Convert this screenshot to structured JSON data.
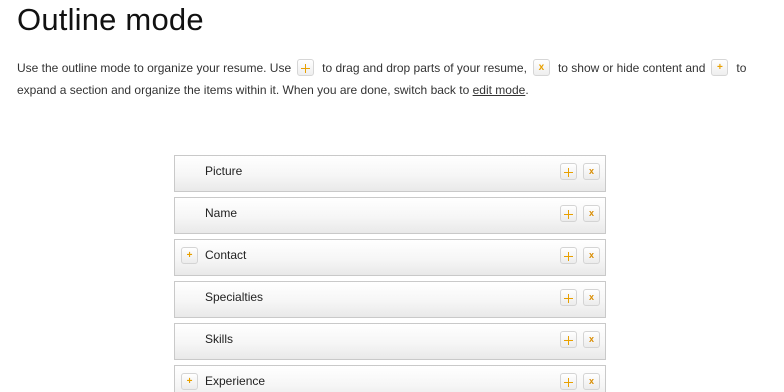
{
  "page": {
    "title": "Outline mode"
  },
  "intro": {
    "text_1": "Use the outline mode to organize your resume. Use",
    "text_2": "to drag and drop parts of your resume,",
    "text_3": "to show or hide content and",
    "text_4": "to",
    "text_5": "expand a section and organize the items within it. When you are done, switch back to",
    "edit_mode_link": "edit mode",
    "text_6": ".",
    "move_icon": "move-arrows-icon",
    "hide_icon": "x-icon",
    "expand_icon": "plus-icon"
  },
  "outline": {
    "items": [
      {
        "label": "Picture",
        "expandable": false
      },
      {
        "label": "Name",
        "expandable": false
      },
      {
        "label": "Contact",
        "expandable": true
      },
      {
        "label": "Specialties",
        "expandable": false
      },
      {
        "label": "Skills",
        "expandable": false
      },
      {
        "label": "Experience",
        "expandable": true
      }
    ],
    "hide_glyph": "x",
    "expand_glyph": "+"
  },
  "colors": {
    "accent": "#e8a000",
    "item_border": "#c9c9c9"
  }
}
